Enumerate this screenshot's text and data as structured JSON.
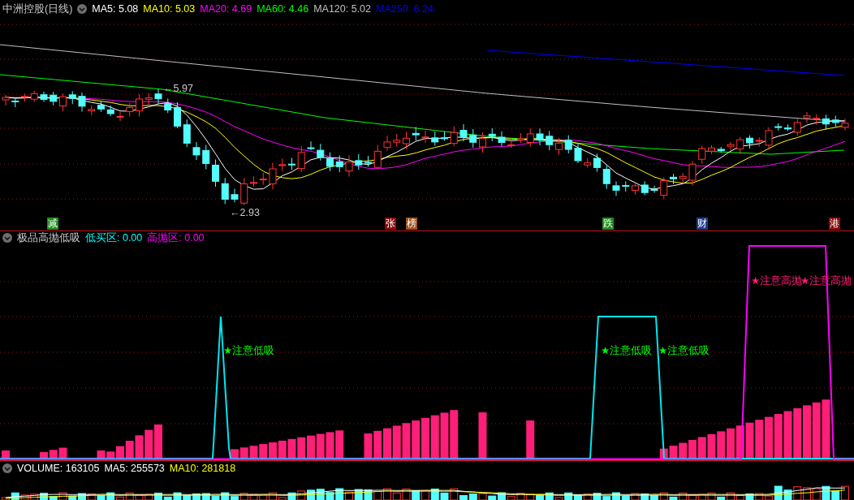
{
  "price_chart": {
    "title": "中洲控股(日线)",
    "ma_legend": [
      {
        "label": "MA5: 5.08",
        "color": "#ffffff"
      },
      {
        "label": "MA10: 5.03",
        "color": "#ffff00"
      },
      {
        "label": "MA20: 4.69",
        "color": "#ff00ff"
      },
      {
        "label": "MA60: 4.46",
        "color": "#00ff00"
      },
      {
        "label": "MA120: 5.02",
        "color": "#c0c0c0"
      },
      {
        "label": "MA250: 6.24",
        "color": "#0000ff"
      }
    ],
    "price_labels": [
      {
        "kind": "high",
        "text": "←5.97"
      },
      {
        "kind": "low",
        "text": "←2.93"
      }
    ],
    "event_markers": [
      {
        "label": "减",
        "color": "#1e8c1e"
      },
      {
        "label": "张",
        "color": "#8b0a0a"
      },
      {
        "label": "榜",
        "color": "#a0521e"
      },
      {
        "label": "跌",
        "color": "#1e8c1e"
      },
      {
        "label": "财",
        "color": "#1e3c8c"
      },
      {
        "label": "港",
        "color": "#8b0a0a"
      }
    ]
  },
  "indicator": {
    "title": "极品高抛低吸",
    "legend": [
      {
        "label": "低买区: 0.00",
        "color": "#00ffff"
      },
      {
        "label": "高抛区: 0.00",
        "color": "#ff00ff"
      }
    ],
    "signals": [
      {
        "kind": "low",
        "text": "★注意低吸"
      },
      {
        "kind": "low",
        "text": "★注意低吸"
      },
      {
        "kind": "low",
        "text": "★注意低吸"
      },
      {
        "kind": "high",
        "text": "★注意高抛"
      },
      {
        "kind": "high",
        "text": "★注意高抛"
      }
    ]
  },
  "volume": {
    "legend": [
      {
        "label": "VOLUME: 163105",
        "color": "#ffffff"
      },
      {
        "label": "MA5: 255573",
        "color": "#ffffff"
      },
      {
        "label": "MA10: 281818",
        "color": "#ffff00"
      }
    ]
  }
}
